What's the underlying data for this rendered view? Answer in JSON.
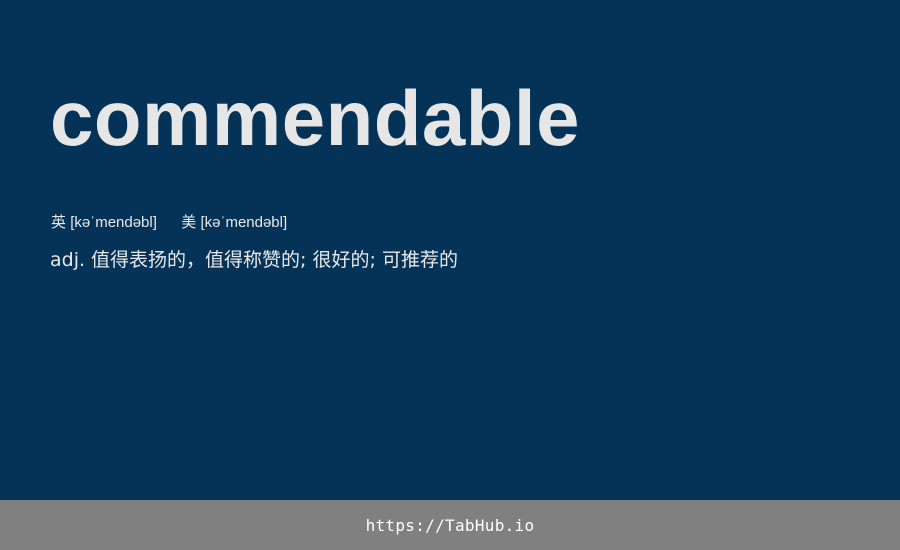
{
  "word": "commendable",
  "phonetics": {
    "uk_label": "英",
    "uk_ipa": "[kəˈmendəbl]",
    "us_label": "美",
    "us_ipa": "[kəˈmendəbl]"
  },
  "definition": {
    "text": "adj. 值得表扬的，值得称赞的; 很好的; 可推荐的"
  },
  "footer": {
    "link_text": "https://TabHub.io"
  },
  "colors": {
    "background": "#053357",
    "word": "#e6e6e6",
    "footer_bg": "#808080"
  }
}
